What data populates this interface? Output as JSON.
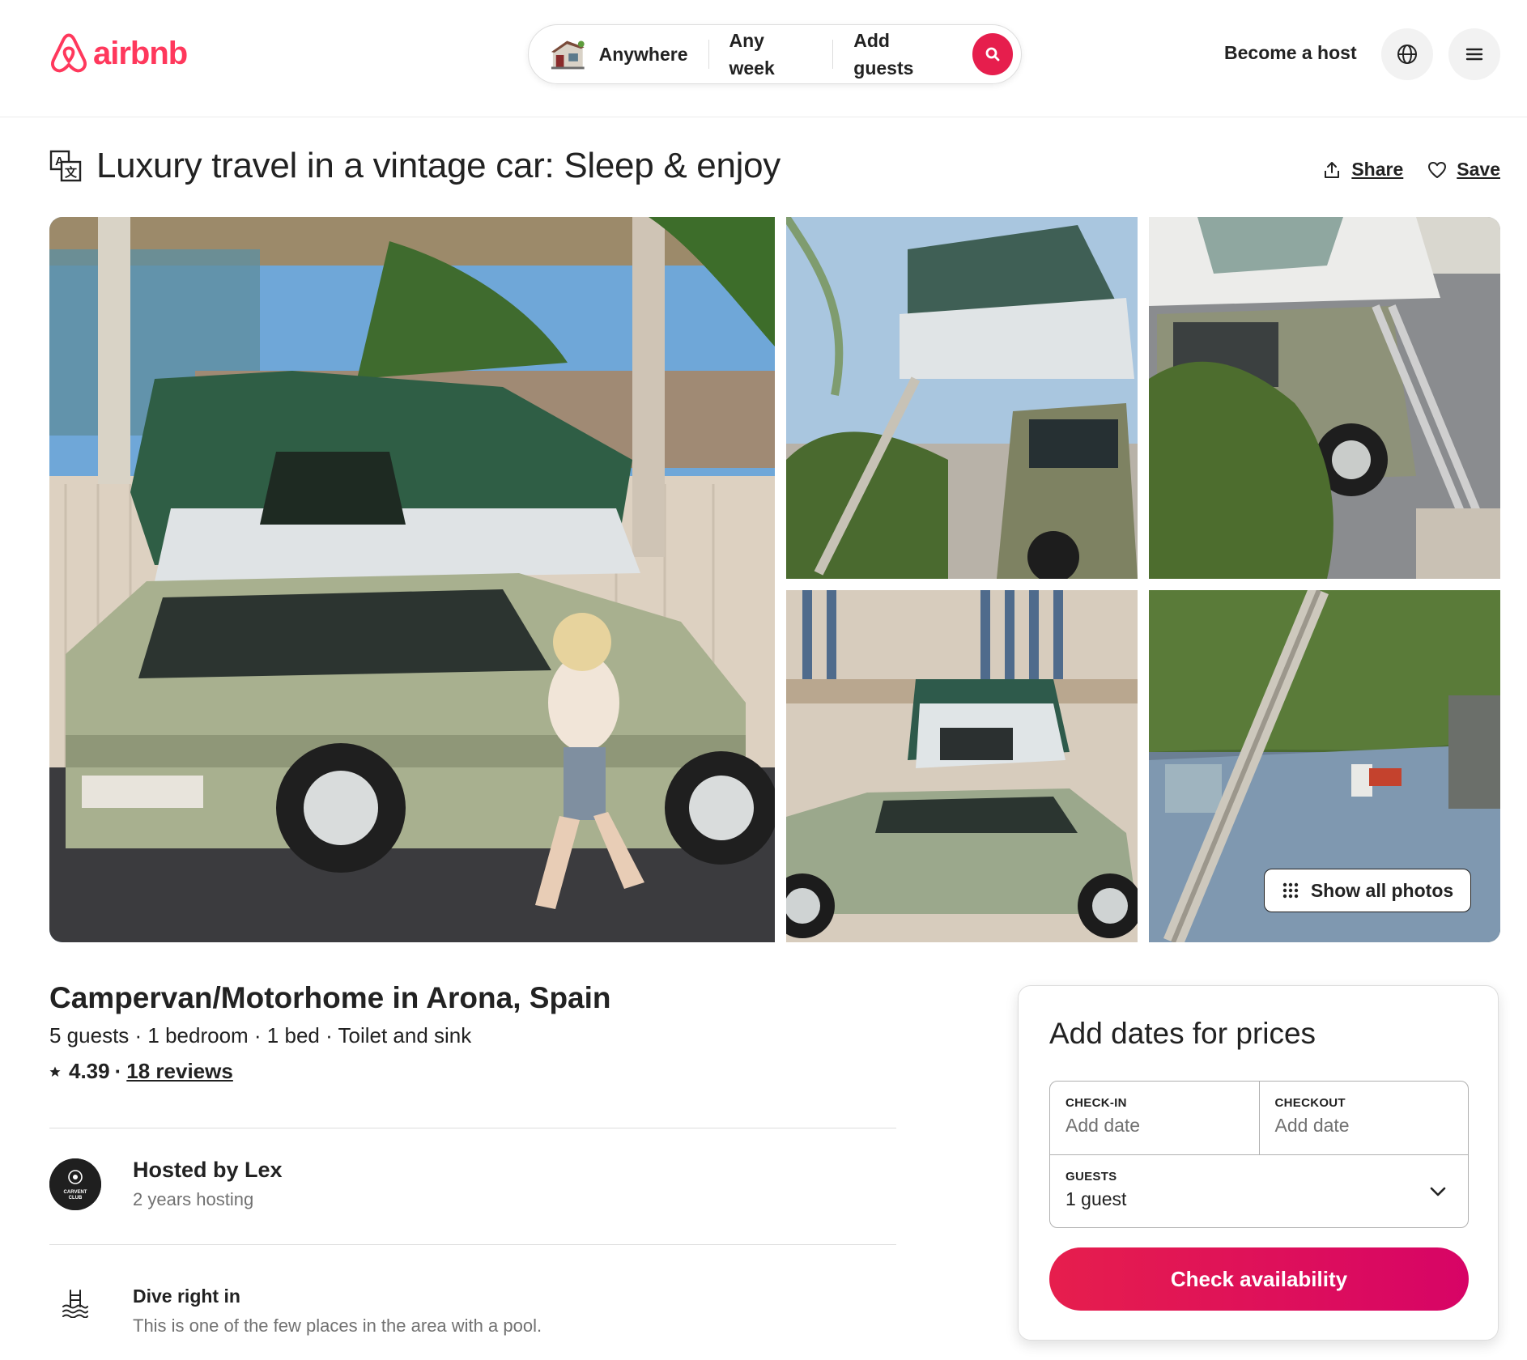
{
  "header": {
    "logo_text": "airbnb",
    "search": {
      "location": "Anywhere",
      "dates": "Any week",
      "guests": "Add guests"
    },
    "become_host": "Become a host",
    "icons": [
      "airbnb-logo-icon",
      "house-icon",
      "search-icon",
      "globe-icon",
      "menu-icon"
    ]
  },
  "listing": {
    "title": "Luxury travel in a vintage car: Sleep & enjoy",
    "share_label": "Share",
    "save_label": "Save",
    "show_all_photos": "Show all photos",
    "type_location": "Campervan/Motorhome in Arona, Spain",
    "facts": "5 guests · 1 bedroom · 1 bed · Toilet and sink",
    "rating": "4.39",
    "rating_separator": "·",
    "reviews": "18 reviews"
  },
  "host": {
    "title": "Hosted by Lex",
    "subtitle": "2 years hosting",
    "avatar_lines": [
      "CARVENT",
      "CLUB"
    ]
  },
  "highlight": {
    "title": "Dive right in",
    "description": "This is one of the few places in the area with a pool."
  },
  "booking": {
    "title": "Add dates for prices",
    "checkin_label": "CHECK-IN",
    "checkin_value": "Add date",
    "checkout_label": "CHECKOUT",
    "checkout_value": "Add date",
    "guests_label": "GUESTS",
    "guests_value": "1 guest",
    "button_label": "Check availability"
  },
  "colors": {
    "brand": "#FF385C",
    "cta_start": "#E61E4D",
    "cta_end": "#D70466",
    "text": "#222222",
    "muted": "#717171",
    "border": "#DDDDDD"
  }
}
